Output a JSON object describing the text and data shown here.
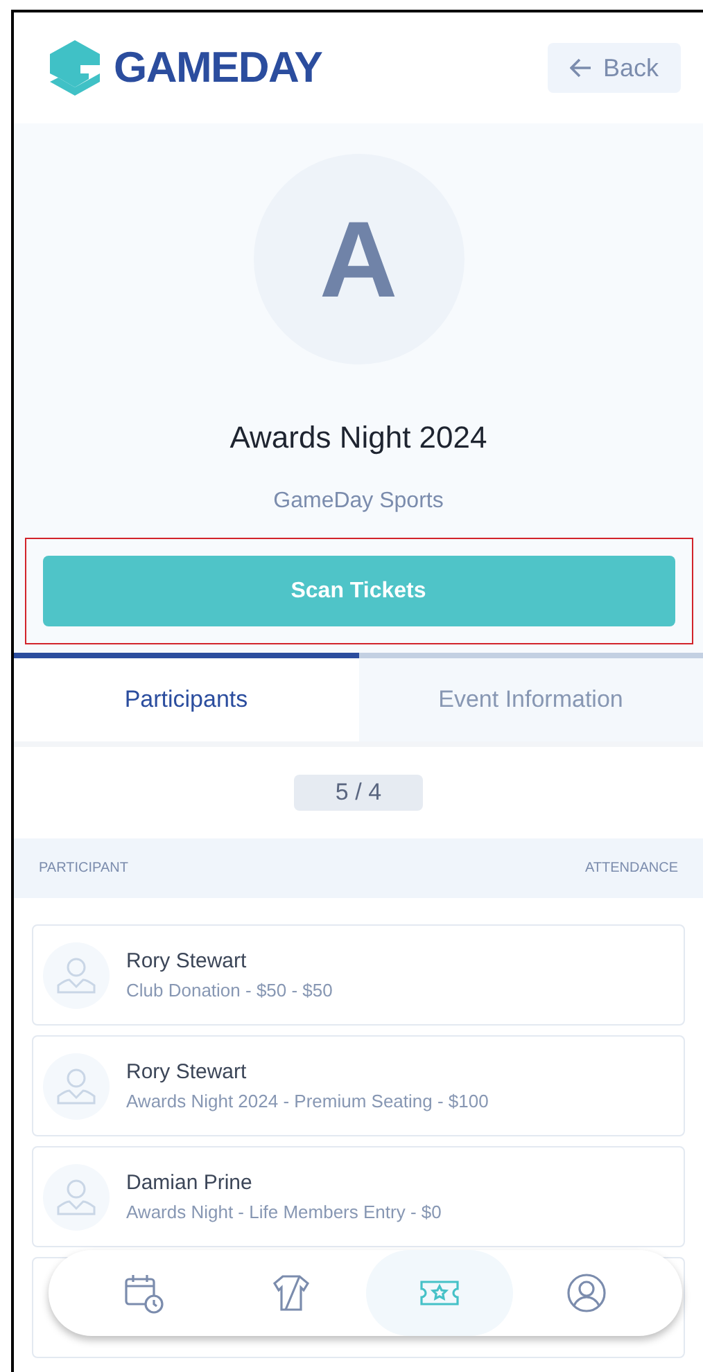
{
  "header": {
    "logo": "GAMEDAY",
    "back_button": "Back"
  },
  "event": {
    "initial": "A",
    "title": "Awards Night 2024",
    "organiser": "GameDay Sports"
  },
  "scan_button": {
    "label": "Scan Tickets",
    "highlighted": true
  },
  "tabs": [
    {
      "label": "Participants",
      "selected": true
    },
    {
      "label": "Event Information",
      "selected": false
    }
  ],
  "count": {
    "checked_in": "5",
    "separator": "/",
    "total": "4"
  },
  "table": {
    "columns": [
      "PARTICIPANT",
      "ATTENDANCE"
    ],
    "rows": [
      {
        "name": "Rory Stewart",
        "ticket": "Club Donation - $50 - $50"
      },
      {
        "name": "Rory Stewart",
        "ticket": "Awards Night 2024 - Premium Seating - $100"
      },
      {
        "name": "Damian Prine",
        "ticket": "Awards Night - Life Members Entry - $0"
      },
      {
        "kind": "hidden"
      }
    ]
  },
  "bottom_nav": [
    {
      "kind": "schedule",
      "selected": false
    },
    {
      "kind": "jersey",
      "selected": false
    },
    {
      "kind": "tickets",
      "selected": true
    },
    {
      "kind": "profile",
      "selected": false
    }
  ]
}
